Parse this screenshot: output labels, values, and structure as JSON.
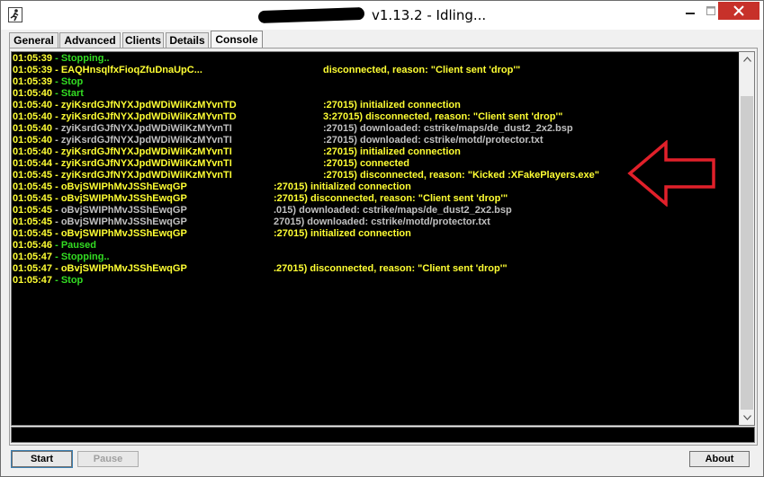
{
  "window": {
    "title_version": "v1.13.2 - Idling...",
    "title_redacted": true
  },
  "colors": {
    "console_bg": "#000000",
    "status_green": "#33dd22",
    "log_yellow": "#ffff33",
    "log_gray": "#c0c0c0",
    "arrow_red": "#e0202a",
    "close_red": "#c7312a"
  },
  "tabs": [
    {
      "label": "General",
      "active": false
    },
    {
      "label": "Advanced",
      "active": false
    },
    {
      "label": "Clients",
      "active": false
    },
    {
      "label": "Details",
      "active": false
    },
    {
      "label": "Console",
      "active": true
    }
  ],
  "console": {
    "lines": [
      {
        "time": "01:05:39",
        "text": "Stopping..",
        "color": "green"
      },
      {
        "time": "01:05:39",
        "text": "EAQHnsqlfxFioqZfuDnaUpC...",
        "suffix": "disconnected, reason: \"Client sent 'drop'\"",
        "color": "yellow"
      },
      {
        "time": "01:05:39",
        "text": "Stop",
        "color": "green"
      },
      {
        "time": "01:05:40",
        "text": "Start",
        "color": "green"
      },
      {
        "time": "01:05:40",
        "text": "zyiKsrdGJfNYXJpdWDiWiIKzMYvnTD",
        "suffix": ":27015) initialized connection",
        "color": "yellow"
      },
      {
        "time": "01:05:40",
        "text": "zyiKsrdGJfNYXJpdWDiWiIKzMYvnTD",
        "suffix": "3:27015) disconnected, reason: \"Client sent 'drop'\"",
        "color": "yellow"
      },
      {
        "time": "01:05:40",
        "text": "zyiKsrdGJfNYXJpdWDiWiIKzMYvnTI",
        "suffix": ":27015) downloaded: cstrike/maps/de_dust2_2x2.bsp",
        "color": "gray"
      },
      {
        "time": "01:05:40",
        "text": "zyiKsrdGJfNYXJpdWDiWiIKzMYvnTI",
        "suffix": ":27015) downloaded: cstrike/motd/protector.txt",
        "color": "gray"
      },
      {
        "time": "01:05:40",
        "text": "zyiKsrdGJfNYXJpdWDiWiIKzMYvnTI",
        "suffix": ":27015) initialized connection",
        "color": "yellow"
      },
      {
        "time": "01:05:44",
        "text": "zyiKsrdGJfNYXJpdWDiWiIKzMYvnTI",
        "suffix": ":27015) connected",
        "color": "yellow"
      },
      {
        "time": "01:05:45",
        "text": "zyiKsrdGJfNYXJpdWDiWiIKzMYvnTI",
        "suffix": ":27015) disconnected, reason: \"Kicked :XFakePlayers.exe\"",
        "color": "yellow"
      },
      {
        "time": "01:05:45",
        "text": "oBvjSWIPhMvJSShEwqGP",
        "suffix": ":27015) initialized connection",
        "color": "yellow"
      },
      {
        "time": "01:05:45",
        "text": "oBvjSWIPhMvJSShEwqGP",
        "suffix": ":27015) disconnected, reason: \"Client sent 'drop'\"",
        "color": "yellow"
      },
      {
        "time": "01:05:45",
        "text": "oBvjSWIPhMvJSShEwqGP",
        "suffix": ".015) downloaded: cstrike/maps/de_dust2_2x2.bsp",
        "color": "gray"
      },
      {
        "time": "01:05:45",
        "text": "oBvjSWIPhMvJSShEwqGP",
        "suffix": "27015) downloaded: cstrike/motd/protector.txt",
        "color": "gray"
      },
      {
        "time": "01:05:45",
        "text": "oBvjSWIPhMvJSShEwqGP",
        "suffix": ":27015) initialized connection",
        "color": "yellow"
      },
      {
        "time": "01:05:46",
        "text": "Paused",
        "color": "green"
      },
      {
        "time": "01:05:47",
        "text": "Stopping..",
        "color": "green"
      },
      {
        "time": "01:05:47",
        "text": "oBvjSWIPhMvJSShEwqGP",
        "suffix": ".27015) disconnected, reason: \"Client sent 'drop'\"",
        "color": "yellow"
      },
      {
        "time": "01:05:47",
        "text": "Stop",
        "color": "green"
      }
    ]
  },
  "buttons": {
    "start_label": "Start",
    "pause_label": "Pause",
    "about_label": "About"
  },
  "annotation": {
    "arrow_icon": "red-outline-arrow-left-icon"
  }
}
